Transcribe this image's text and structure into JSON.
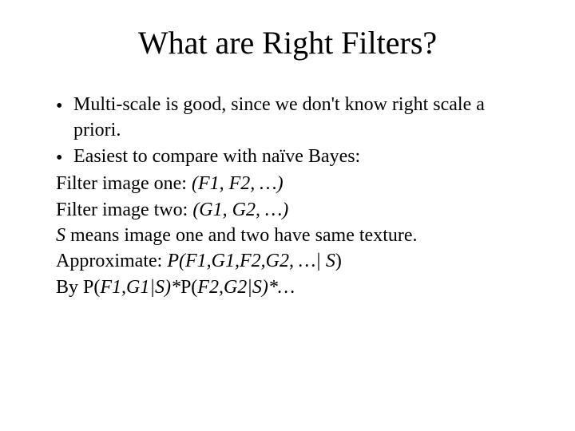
{
  "title": "What are Right Filters?",
  "bullet1": "Multi-scale is good, since we don't know right scale a priori.",
  "bullet2": "Easiest to compare with naïve Bayes:",
  "line1_a": "Filter image one: ",
  "line1_b": "(F1, F2, …)",
  "line2_a": "Filter image two: ",
  "line2_b": "(G1, G2, …)",
  "line3_a": "S",
  "line3_b": " means image one and two have same texture.",
  "line4_a": "Approximate: ",
  "line4_b": "P(F1,G1,F2,G2, …| S",
  "line4_c": ")",
  "line5_a": "By P(",
  "line5_b": "F1,G1|S)*",
  "line5_c": "P(",
  "line5_d": "F2,G2|S)*…",
  "dot": "•"
}
